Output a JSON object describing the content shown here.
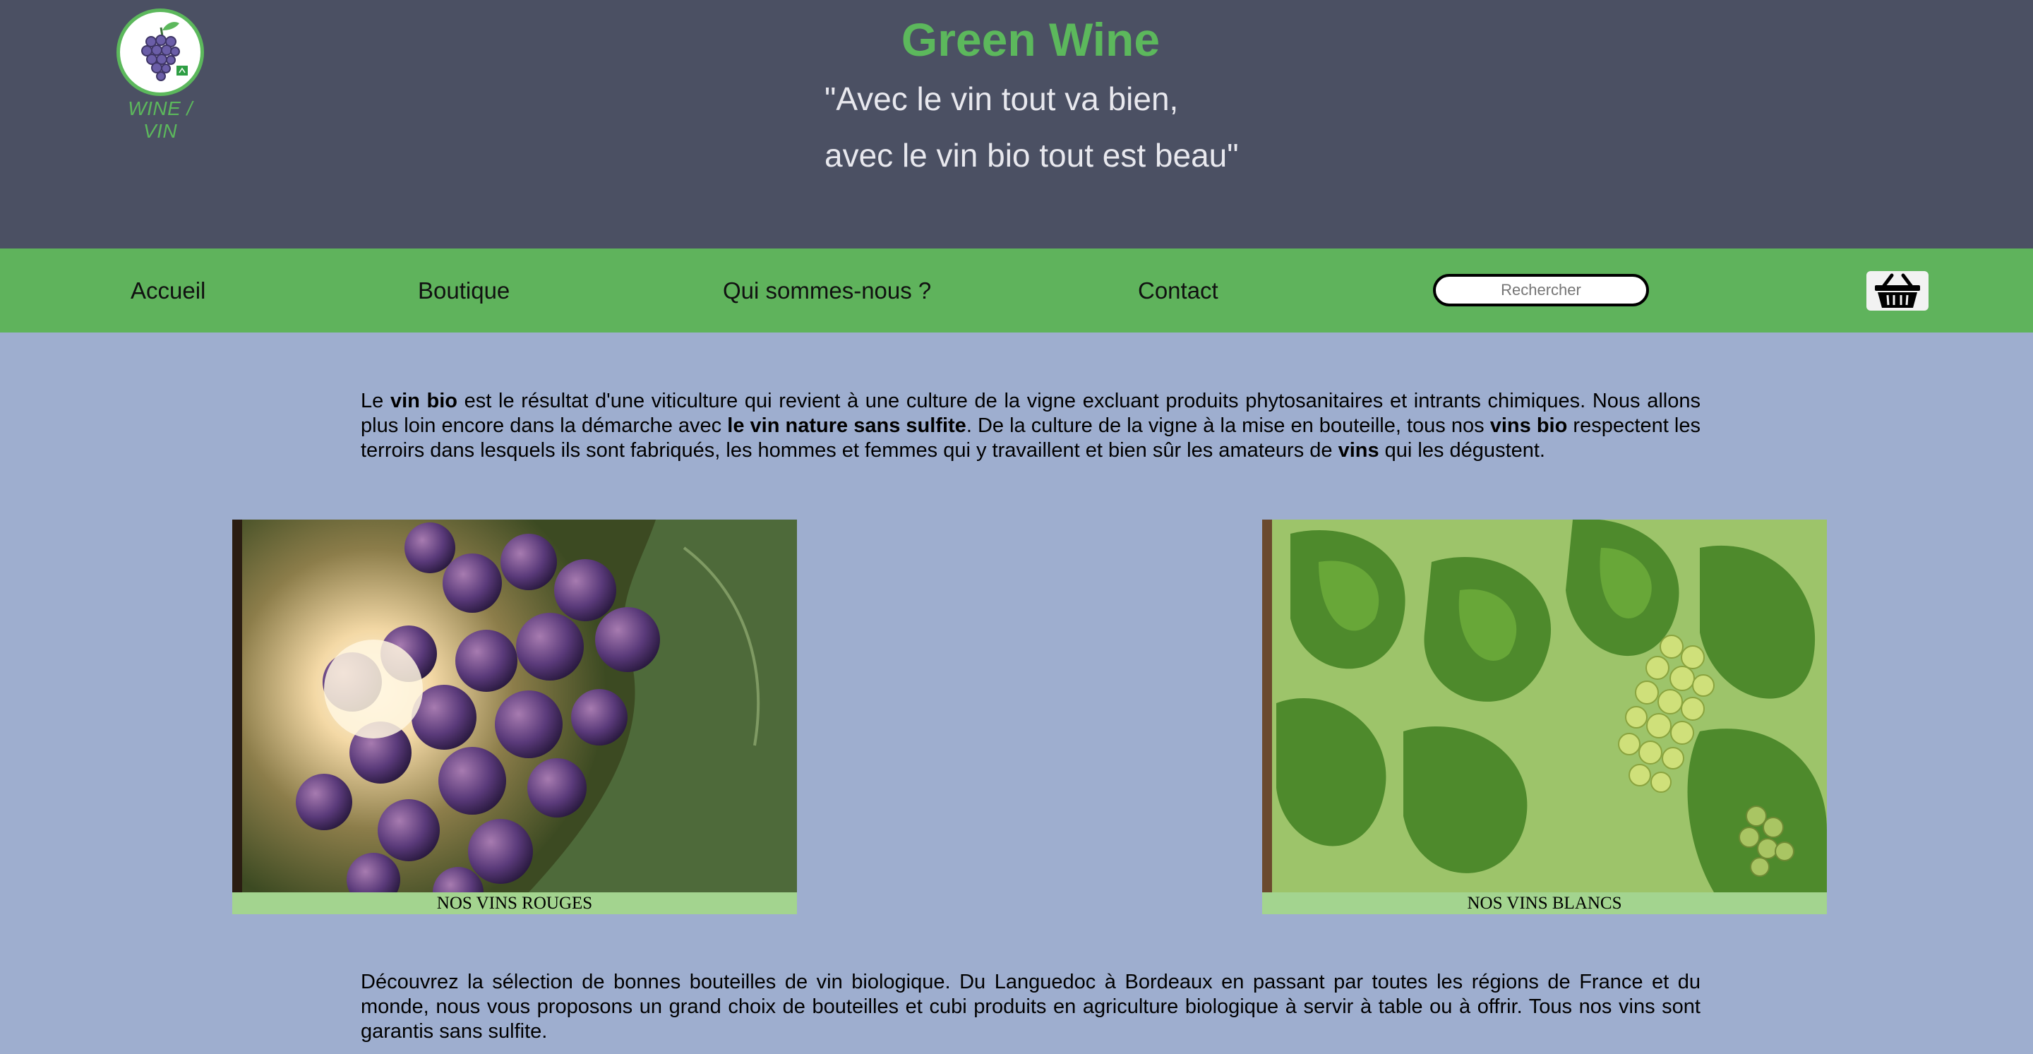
{
  "header": {
    "logo_caption": "WINE / VIN",
    "title": "Green Wine",
    "slogan_line1": "\"Avec le vin tout va bien,",
    "slogan_line2": "avec le vin bio tout est beau\""
  },
  "nav": {
    "items": [
      {
        "label": "Accueil"
      },
      {
        "label": "Boutique"
      },
      {
        "label": "Qui sommes-nous ?"
      },
      {
        "label": "Contact"
      }
    ],
    "search_placeholder": "Rechercher",
    "cart_icon": "basket-icon"
  },
  "intro": {
    "t1": "Le ",
    "b1": "vin bio",
    "t2": " est le résultat d'une viticulture qui revient à une culture de la vigne excluant produits phytosanitaires et intrants chimiques. Nous allons plus loin encore dans la démarche avec ",
    "b2": "le vin nature sans sulfite",
    "t3": ". De la culture de la vigne à la mise en bouteille, tous nos ",
    "b3": "vins bio",
    "t4": " respectent les terroirs dans lesquels ils sont fabriqués, les hommes et femmes qui y travaillent et bien sûr les amateurs de ",
    "b4": "vins",
    "t5": " qui les dégustent."
  },
  "cards": [
    {
      "label": "NOS VINS ROUGES"
    },
    {
      "label": "NOS VINS BLANCS"
    }
  ],
  "outro": "Découvrez la sélection de bonnes bouteilles de vin biologique. Du Languedoc à Bordeaux en passant par toutes les régions de France et du monde, nous vous proposons un grand choix de bouteilles et cubi produits en agriculture biologique à servir à table ou à offrir. Tous nos vins sont garantis sans sulfite.",
  "colors": {
    "header_bg": "#4b5063",
    "accent_green": "#5cb85c",
    "nav_bg": "#5fb35c",
    "page_bg": "#9eaecf",
    "card_label_bg": "#a3d48f"
  }
}
